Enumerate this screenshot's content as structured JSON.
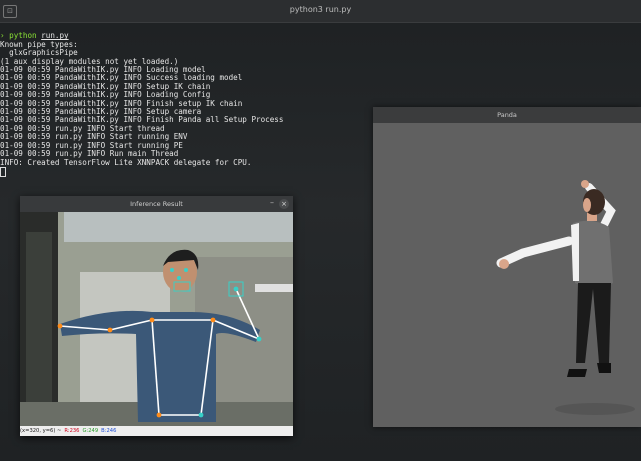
{
  "terminal": {
    "title": "python3 run.py",
    "tab_icon": "⊡",
    "prompt_symbol": "›",
    "command_prefix": "python",
    "command_file": "run.py",
    "lines": [
      "Known pipe types:",
      "  glxGraphicsPipe",
      "(1 aux display modules not yet loaded.)",
      "01-09 00:59 PandaWithIK.py INFO Loading model",
      "01-09 00:59 PandaWithIK.py INFO Success loading model",
      "01-09 00:59 PandaWithIK.py INFO Setup IK chain",
      "01-09 00:59 PandaWithIK.py INFO Loading Config",
      "01-09 00:59 PandaWithIK.py INFO Finish setup IK chain",
      "01-09 00:59 PandaWithIK.py INFO Setup camera",
      "01-09 00:59 PandaWithIK.py INFO Finish Panda all Setup Process",
      "01-09 00:59 run.py INFO Start thread",
      "01-09 00:59 run.py INFO Start running ENV",
      "01-09 00:59 run.py INFO Start running PE",
      "01-09 00:59 run.py INFO Run main Thread",
      "INFO: Created TensorFlow Lite XNNPACK delegate for CPU."
    ]
  },
  "panda_window": {
    "title": "Panda"
  },
  "inference_window": {
    "title": "Inference Result",
    "minimize_label": "–",
    "close_label": "×",
    "status": {
      "coords": "(x=320, y=6) ~",
      "r": "R:236",
      "g": "G:249",
      "b": "B:246"
    },
    "status_colors": {
      "r": "#d0021b",
      "g": "#2a9d2a",
      "b": "#1f4fd6"
    }
  },
  "colors": {
    "terminal_bg": "#1e2123",
    "prompt_green": "#8ae234",
    "pose_line": "#ffffff",
    "pose_joint": "#ff8c1a",
    "pose_face": "#37d0c8"
  }
}
